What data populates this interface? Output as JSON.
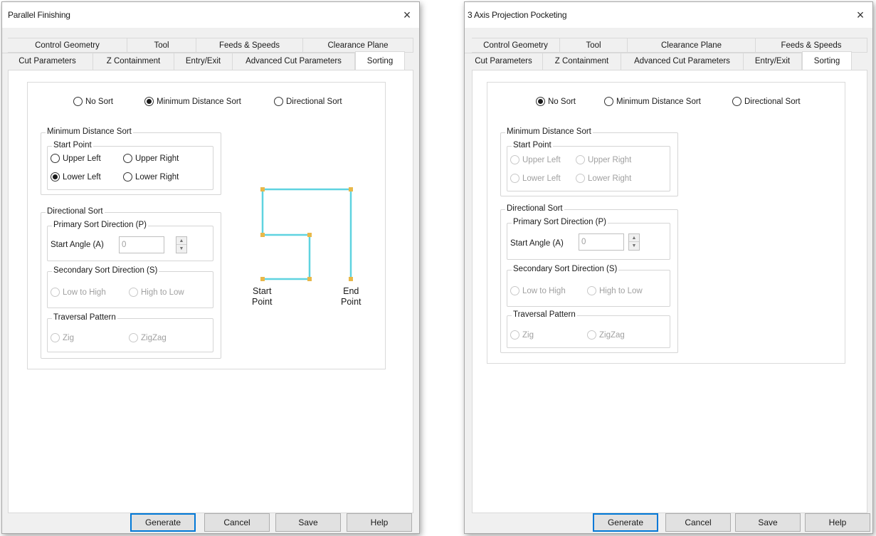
{
  "dialog1": {
    "title": "Parallel Finishing",
    "close_symbol": "×",
    "tabs_back": [
      "Control Geometry",
      "Tool",
      "Feeds & Speeds",
      "Clearance Plane"
    ],
    "tabs_front": [
      "Cut Parameters",
      "Z Containment",
      "Entry/Exit",
      "Advanced Cut Parameters",
      "Sorting"
    ],
    "active_tab": "Sorting",
    "sort_options": [
      "No Sort",
      "Minimum Distance Sort",
      "Directional Sort"
    ],
    "selected_sort": "Minimum Distance Sort",
    "min_distance_group": "Minimum Distance Sort",
    "start_point_group": "Start Point",
    "start_points": [
      "Upper Left",
      "Upper Right",
      "Lower Left",
      "Lower Right"
    ],
    "selected_start_point": "Lower Left",
    "directional_group": "Directional Sort",
    "primary_group": "Primary Sort Direction (P)",
    "start_angle_label": "Start Angle (A)",
    "start_angle_value": "0",
    "secondary_group": "Secondary Sort Direction (S)",
    "secondary_options": [
      "Low to High",
      "High to Low"
    ],
    "traversal_group": "Traversal Pattern",
    "traversal_options": [
      "Zig",
      "ZigZag"
    ],
    "diagram": {
      "start_label": "Start\nPoint",
      "end_label": "End\nPoint",
      "path_color": "#5fd3e0",
      "node_color": "#e8b84a"
    },
    "buttons": [
      "Generate",
      "Cancel",
      "Save",
      "Help"
    ]
  },
  "dialog2": {
    "title": "3 Axis Projection Pocketing",
    "close_symbol": "×",
    "tabs_back": [
      "Control Geometry",
      "Tool",
      "Clearance Plane",
      "Feeds & Speeds"
    ],
    "tabs_front": [
      "Cut Parameters",
      "Z Containment",
      "Advanced Cut Parameters",
      "Entry/Exit",
      "Sorting"
    ],
    "active_tab": "Sorting",
    "sort_options": [
      "No Sort",
      "Minimum Distance Sort",
      "Directional Sort"
    ],
    "selected_sort": "No Sort",
    "min_distance_group": "Minimum Distance Sort",
    "start_point_group": "Start Point",
    "start_points": [
      "Upper Left",
      "Upper Right",
      "Lower Left",
      "Lower Right"
    ],
    "directional_group": "Directional Sort",
    "primary_group": "Primary Sort Direction (P)",
    "start_angle_label": "Start Angle (A)",
    "start_angle_value": "0",
    "secondary_group": "Secondary Sort Direction (S)",
    "secondary_options": [
      "Low to High",
      "High to Low"
    ],
    "traversal_group": "Traversal Pattern",
    "traversal_options": [
      "Zig",
      "ZigZag"
    ],
    "buttons": [
      "Generate",
      "Cancel",
      "Save",
      "Help"
    ]
  }
}
